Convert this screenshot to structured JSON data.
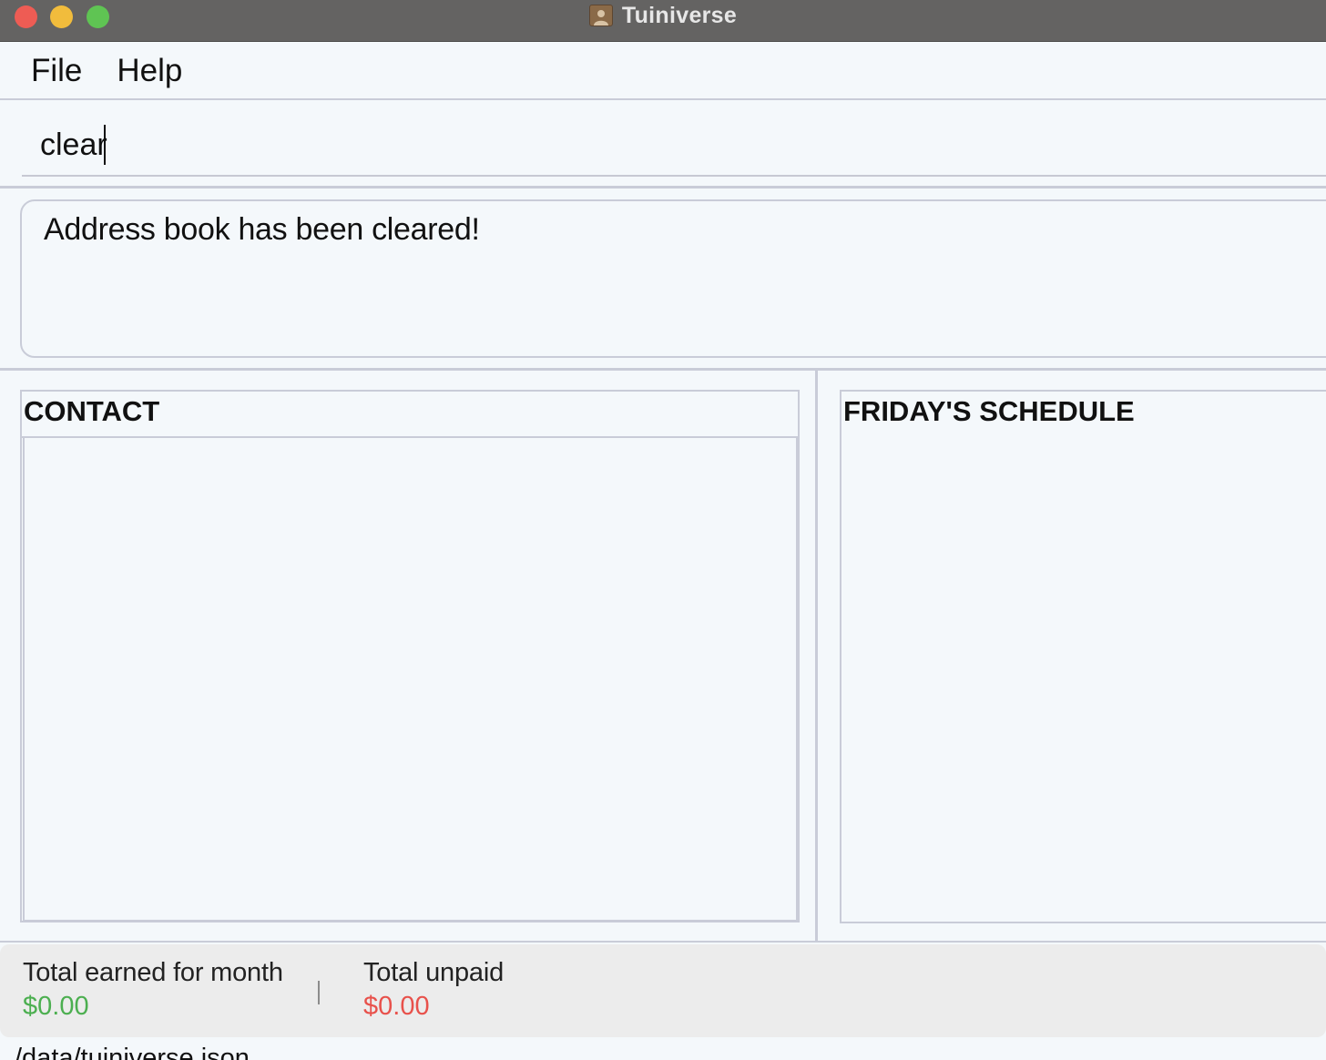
{
  "window": {
    "title": "Tuiniverse",
    "app_icon": "address-book-icon",
    "controls": [
      "close",
      "minimize",
      "zoom"
    ]
  },
  "menu": {
    "items": [
      {
        "label": "File"
      },
      {
        "label": "Help"
      }
    ]
  },
  "command": {
    "value": "clear"
  },
  "result": {
    "message": "Address book has been cleared!"
  },
  "contact_panel": {
    "title": "CONTACT",
    "items": []
  },
  "schedule_panel": {
    "title": "FRIDAY'S SCHEDULE",
    "items": []
  },
  "earnings": {
    "earned_label": "Total earned for month",
    "earned_value": "$0.00",
    "divider": "|",
    "unpaid_label": "Total unpaid",
    "unpaid_value": "$0.00",
    "earned_color": "#4caf50",
    "unpaid_color": "#e8514b"
  },
  "status": {
    "file_path": "/data/tuiniverse.json"
  }
}
